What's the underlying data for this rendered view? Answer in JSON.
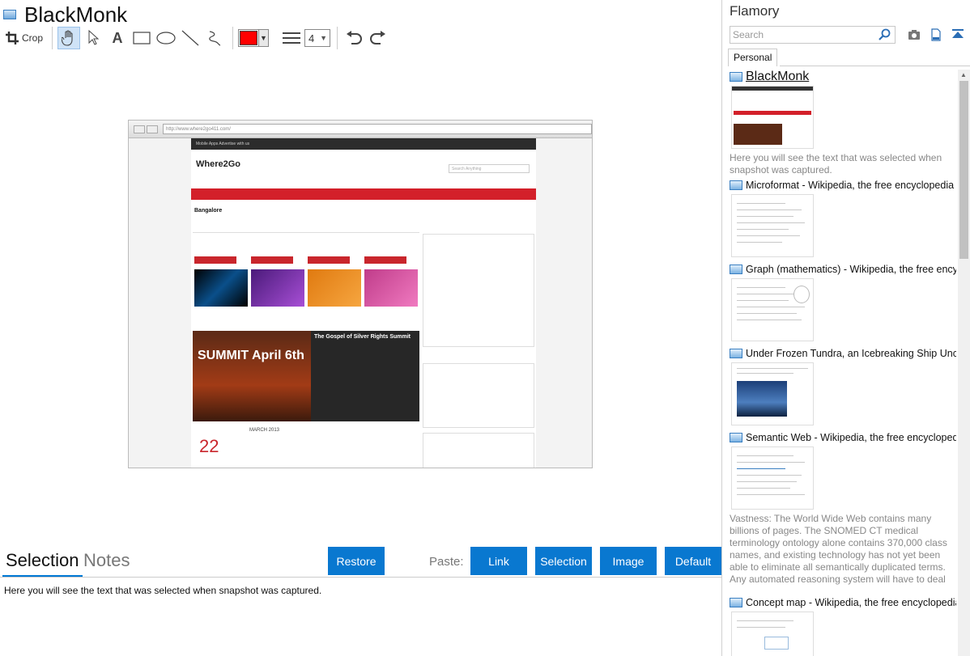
{
  "window": {
    "title": "BlackMonk"
  },
  "toolbar": {
    "crop_label": "Crop",
    "color": "#ff0000",
    "line_width": "4"
  },
  "snapshot": {
    "url": "http://www.where2go411.com/",
    "top_links": "Mobile Apps    Advertise with us",
    "logo": "Where2Go",
    "search_placeholder": "Search Anything",
    "city": "Bangalore",
    "banner_title": "The Gospel of Silver Rights Summit",
    "banner_text": "SUMMIT April 6th",
    "cal_month": "MARCH 2013",
    "cal_day": "22"
  },
  "bottom": {
    "tab_selection": "Selection",
    "tab_notes": "Notes",
    "restore_label": "Restore",
    "paste_label": "Paste:",
    "link_label": "Link",
    "selection_label": "Selection",
    "image_label": "Image",
    "default_label": "Default",
    "selection_text": "Here you will see the text that was selected when snapshot was captured."
  },
  "sidebar": {
    "title": "Flamory",
    "search_placeholder": "Search",
    "tab_personal": "Personal",
    "entries": [
      {
        "name": "BlackMonk",
        "desc": "Here you will see the text that was selected when snapshot was captured."
      },
      {
        "name": "Microformat - Wikipedia, the free encyclopedia",
        "desc": ""
      },
      {
        "name": "Graph (mathematics) - Wikipedia, the free ency",
        "desc": ""
      },
      {
        "name": "Under Frozen Tundra, an Icebreaking Ship Unco",
        "desc": ""
      },
      {
        "name": "Semantic Web - Wikipedia, the free encycloped",
        "desc": "Vastness: The World Wide Web contains many billions of pages. The SNOMED CT medical terminology ontology alone contains 370,000 class names, and existing technology has not yet been able to eliminate all semantically duplicated terms. Any automated reasoning system will have to deal with truly huge inputs."
      },
      {
        "name": "Concept map - Wikipedia, the free encyclopedia",
        "desc": ""
      }
    ]
  }
}
